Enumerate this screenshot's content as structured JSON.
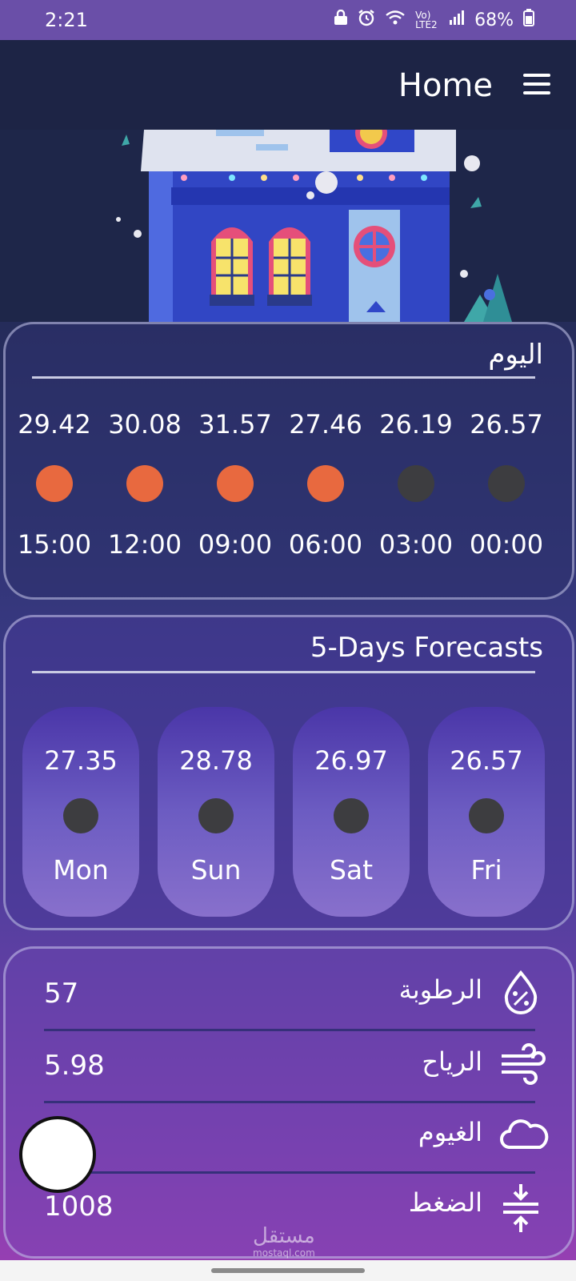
{
  "status_bar": {
    "time": "2:21",
    "network": "Vo) LTE2",
    "battery": "68%",
    "icons": [
      "lock-icon",
      "alarm-icon",
      "wifi-icon",
      "signal-icon",
      "battery-icon"
    ]
  },
  "app_bar": {
    "title": "Home",
    "menu_icon": "hamburger-menu-icon"
  },
  "today": {
    "title": "اليوم",
    "hours": [
      {
        "time": "15:00",
        "temp": "29.42",
        "icon": "sun-icon",
        "color": "#e8693f"
      },
      {
        "time": "12:00",
        "temp": "30.08",
        "icon": "sun-icon",
        "color": "#e8693f"
      },
      {
        "time": "09:00",
        "temp": "31.57",
        "icon": "sun-icon",
        "color": "#e8693f"
      },
      {
        "time": "06:00",
        "temp": "27.46",
        "icon": "sun-icon",
        "color": "#e8693f"
      },
      {
        "time": "03:00",
        "temp": "26.19",
        "icon": "moon-icon",
        "color": "#3d3d40"
      },
      {
        "time": "00:00",
        "temp": "26.57",
        "icon": "moon-icon",
        "color": "#3d3d40"
      }
    ]
  },
  "forecast": {
    "title": "5-Days Forecasts",
    "days": [
      {
        "name": "Mon",
        "temp": "27.35",
        "icon": "moon-icon"
      },
      {
        "name": "Sun",
        "temp": "28.78",
        "icon": "moon-icon"
      },
      {
        "name": "Sat",
        "temp": "26.97",
        "icon": "moon-icon"
      },
      {
        "name": "Fri",
        "temp": "26.57",
        "icon": "moon-icon"
      }
    ]
  },
  "details": {
    "rows": [
      {
        "label": "الرطوبة",
        "value": "57",
        "icon": "humidity-icon"
      },
      {
        "label": "الرياح",
        "value": "5.98",
        "icon": "wind-icon"
      },
      {
        "label": "الغيوم",
        "value": "",
        "icon": "cloud-icon"
      },
      {
        "label": "الضغط",
        "value": "1008",
        "icon": "pressure-icon"
      }
    ]
  },
  "watermark": {
    "text": "مستقل",
    "subtext": "mostaql.com"
  },
  "colors": {
    "status_bar": "#6a4fa8",
    "app_bar": "#1d2445",
    "sun": "#e8693f",
    "moon": "#3d3d40",
    "divider": "#c9cbe3"
  }
}
